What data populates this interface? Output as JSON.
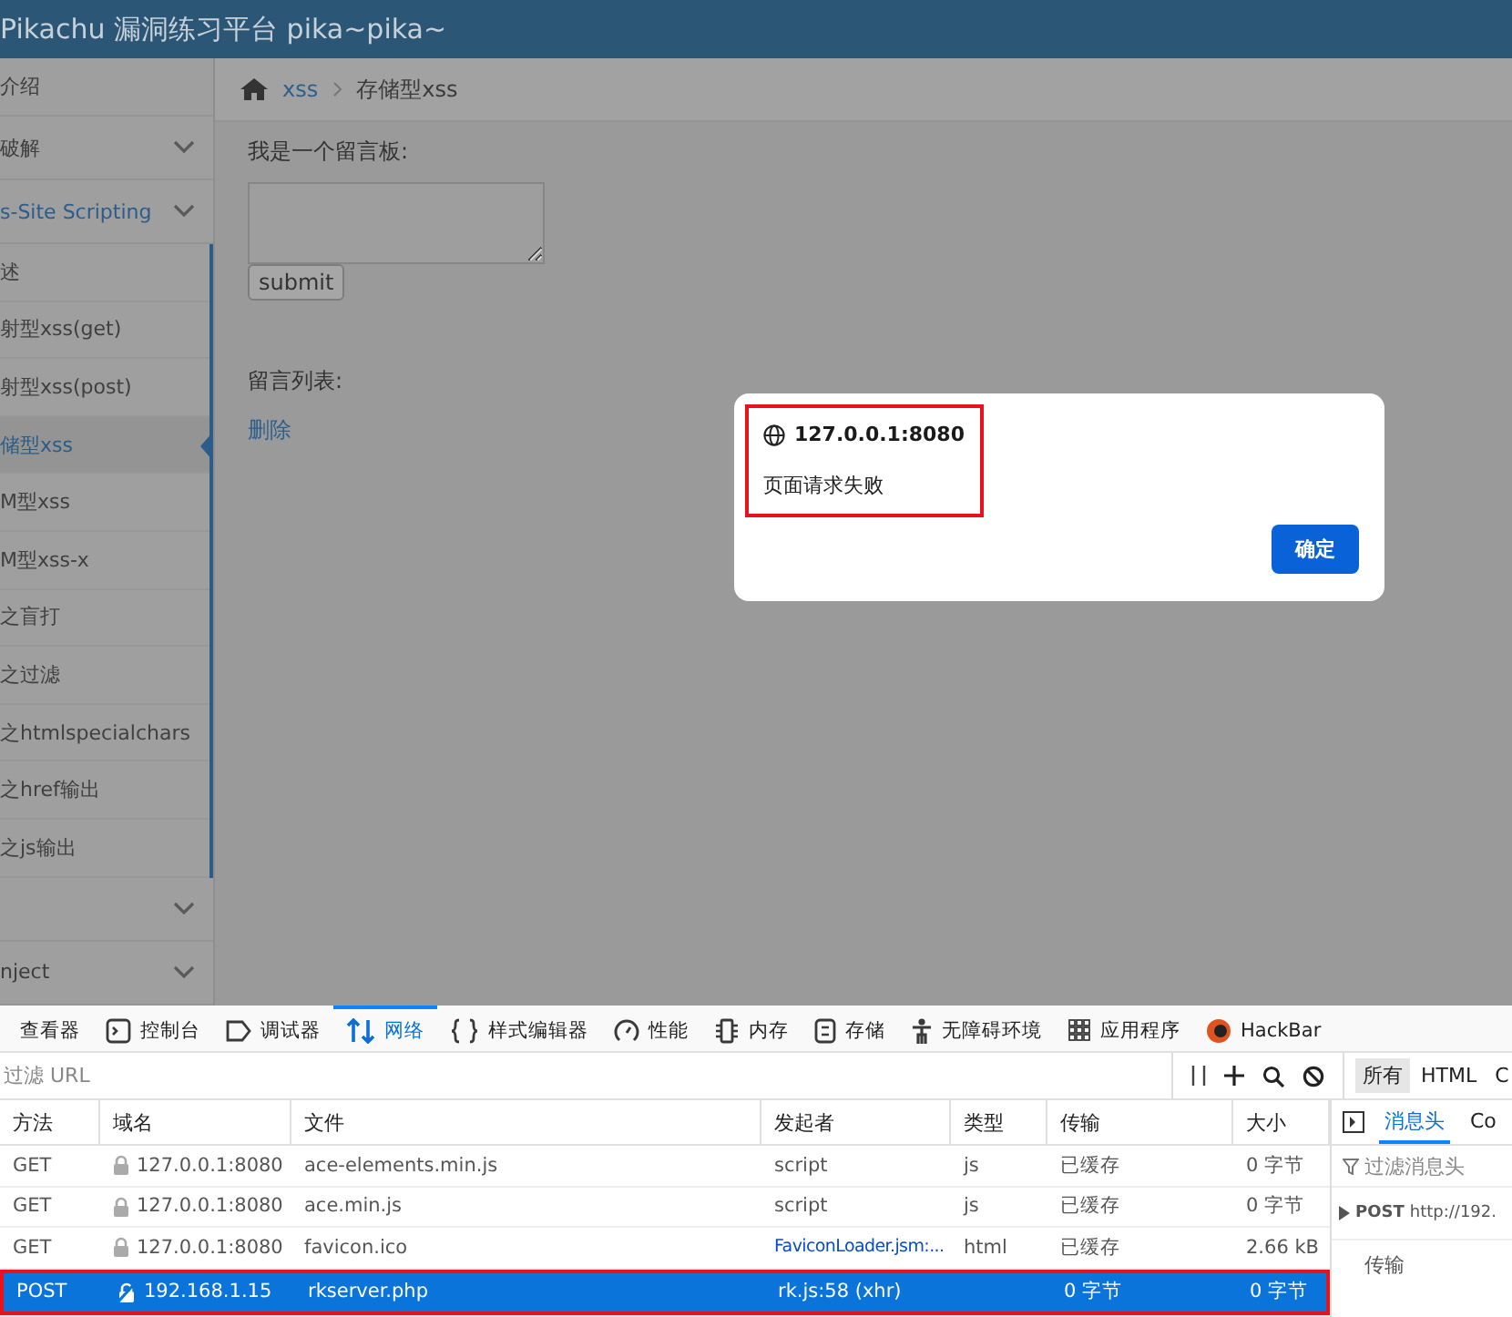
{
  "header": {
    "title": "Pikachu 漏洞练习平台 pika~pika~"
  },
  "sidebar": {
    "items": [
      {
        "label": "介绍",
        "kind": "top",
        "expanded": false
      },
      {
        "label": "破解",
        "kind": "group",
        "expanded": false
      },
      {
        "label": "s-Site Scripting",
        "kind": "group",
        "expanded": true,
        "children": [
          {
            "label": "述",
            "selected": false
          },
          {
            "label": "射型xss(get)",
            "selected": false
          },
          {
            "label": "射型xss(post)",
            "selected": false
          },
          {
            "label": "储型xss",
            "selected": true
          },
          {
            "label": "M型xss",
            "selected": false
          },
          {
            "label": "M型xss-x",
            "selected": false
          },
          {
            "label": "之盲打",
            "selected": false
          },
          {
            "label": "之过滤",
            "selected": false
          },
          {
            "label": "之htmlspecialchars",
            "selected": false
          },
          {
            "label": "之href输出",
            "selected": false
          },
          {
            "label": "之js输出",
            "selected": false
          }
        ]
      },
      {
        "kind": "group",
        "expanded": false
      },
      {
        "label": "nject",
        "kind": "group",
        "expanded": false
      }
    ]
  },
  "breadcrumb": [
    {
      "label": "xss",
      "kind": "link"
    },
    {
      "label": "存储型xss",
      "kind": "current"
    }
  ],
  "board": {
    "label": "我是一个留言板:",
    "submit": "submit",
    "list_label": "留言列表:",
    "delete_link": "删除"
  },
  "dialog": {
    "origin": "127.0.0.1:8080",
    "message": "页面请求失败",
    "button": "确定"
  },
  "devtools": {
    "tabs": [
      {
        "label": "查看器",
        "selected": false
      },
      {
        "label": "控制台",
        "selected": false
      },
      {
        "label": "调试器",
        "selected": false
      },
      {
        "label": "网络",
        "selected": true
      },
      {
        "label": "样式编辑器",
        "selected": false
      },
      {
        "label": "性能",
        "selected": false
      },
      {
        "label": "内存",
        "selected": false
      },
      {
        "label": "存储",
        "selected": false
      },
      {
        "label": "无障碍环境",
        "selected": false
      },
      {
        "label": "应用程序",
        "selected": false
      },
      {
        "label": "HackBar",
        "selected": false
      }
    ],
    "filter": {
      "placeholder": "过滤 URL"
    },
    "type_filters": [
      {
        "label": "所有",
        "selected": true
      },
      {
        "label": "HTML",
        "selected": false
      },
      {
        "label": "C",
        "selected": false
      }
    ],
    "columns": [
      "方法",
      "域名",
      "文件",
      "发起者",
      "类型",
      "传输",
      "大小"
    ],
    "rows": [
      {
        "method": "GET",
        "secure": true,
        "domain": "127.0.0.1:8080",
        "file": "ace-elements.min.js",
        "initiator": "script",
        "initiator_link": false,
        "type": "js",
        "transfer": "已缓存",
        "size": "0 字节",
        "selected": false
      },
      {
        "method": "GET",
        "secure": true,
        "domain": "127.0.0.1:8080",
        "file": "ace.min.js",
        "initiator": "script",
        "initiator_link": false,
        "type": "js",
        "transfer": "已缓存",
        "size": "0 字节",
        "selected": false
      },
      {
        "method": "GET",
        "secure": true,
        "domain": "127.0.0.1:8080",
        "file": "favicon.ico",
        "initiator": "FaviconLoader.jsm:...",
        "initiator_link": true,
        "type": "html",
        "transfer": "已缓存",
        "size": "2.66 kB",
        "selected": false
      },
      {
        "method": "POST",
        "secure": false,
        "domain": "192.168.1.15",
        "file": "rkserver.php",
        "initiator": "rk.js:58 (xhr)",
        "initiator_link": false,
        "transfer": "0 字节",
        "size": "0 字节",
        "selected": true
      }
    ],
    "details": {
      "tabs": [
        {
          "label": "消息头",
          "selected": true
        },
        {
          "label": "Co",
          "selected": false
        }
      ],
      "filter_placeholder": "过滤消息头",
      "request": "POST",
      "url": "http://192.",
      "section": "传输"
    }
  }
}
